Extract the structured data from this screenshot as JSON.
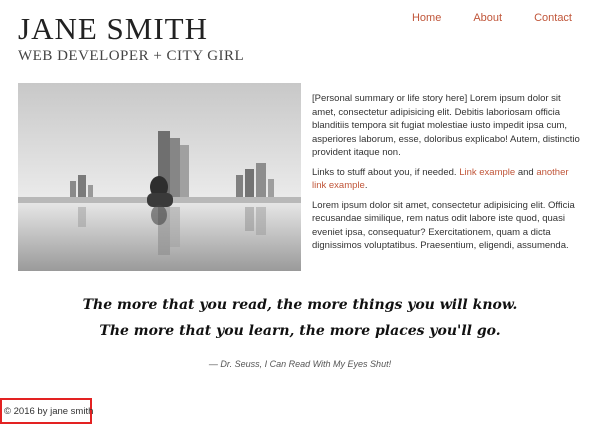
{
  "header": {
    "title": "JANE SMITH",
    "subtitle": "WEB DEVELOPER + CITY GIRL"
  },
  "nav": {
    "items": [
      {
        "label": "Home"
      },
      {
        "label": "About"
      },
      {
        "label": "Contact"
      }
    ]
  },
  "content": {
    "summary": "[Personal summary or life story here] Lorem ipsum dolor sit amet, consectetur adipisicing elit. Debitis laboriosam officia blanditiis tempora sit fugiat molestiae iusto impedit ipsa cum, asperiores laborum, esse, doloribus explicabo! Autem, distinctio provident itaque non.",
    "links_intro": "Links to stuff about you, if needed.",
    "link1": "Link example",
    "link_and": "and",
    "link2": "another link example",
    "closing": "Lorem ipsum dolor sit amet, consectetur adipisicing elit. Officia recusandae similique, rem natus odit labore iste quod, quasi eveniet ipsa, consequatur? Exercitationem, quam a dicta dignissimos voluptatibus. Praesentium, eligendi, assumenda."
  },
  "quote": {
    "line1": "The more that you read, the more things you will know.",
    "line2": "The more that you learn, the more places you'll go.",
    "attribution": "— Dr. Seuss, I Can Read With My Eyes Shut!"
  },
  "footer": {
    "text": "© 2016 by jane smith"
  },
  "colors": {
    "accent": "#c0563a",
    "highlight_border": "#e32222"
  }
}
